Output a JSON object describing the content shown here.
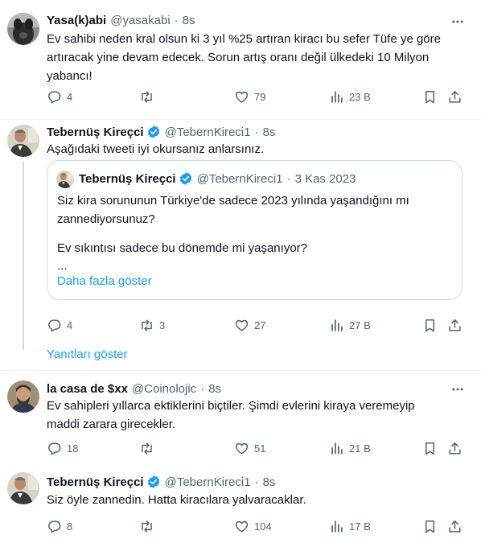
{
  "colors": {
    "accent": "#1d9bf0",
    "muted": "#536471",
    "text": "#0f1419",
    "border": "#cfd9de"
  },
  "tweets": [
    {
      "name": "Yasa(k)abi",
      "handle": "@yasakabi",
      "time": "8s",
      "verified": false,
      "text": "Ev sahibi neden kral olsun ki 3 yıl %25 artıran kiracı bu sefer Tüfe ye göre artıracak yine devam edecek. Sorun artış oranı değil ülkedeki 10 Milyon yabancı!",
      "replies": "4",
      "retweets": "",
      "likes": "79",
      "views": "23 B"
    },
    {
      "name": "Tebernüş Kireçci",
      "handle": "@TebernKireci1",
      "time": "8s",
      "verified": true,
      "text": "Aşağıdaki tweeti iyi okursanız anlarsınız.",
      "replies": "4",
      "retweets": "3",
      "likes": "27",
      "views": "27 B",
      "quote": {
        "name": "Tebernüş Kireçci",
        "handle": "@TebernKireci1",
        "date": "3 Kas 2023",
        "line1": "Siz kira sorununun Türkiye'de sadece 2023 yılında yaşandığını mı zannediyorsunuz?",
        "line2": "Ev sıkıntısı sadece bu dönemde mi yaşanıyor?",
        "ellipsis": "...",
        "show_more": "Daha fazla göster"
      }
    },
    {
      "name": "la casa de $xx",
      "handle": "@Coinolojic",
      "time": "8s",
      "verified": false,
      "text": "Ev sahipleri yıllarca ektiklerini biçtiler. Şimdi evlerini kiraya veremeyip maddi zarara girecekler.",
      "replies": "18",
      "retweets": "",
      "likes": "51",
      "views": "21 B"
    },
    {
      "name": "Tebernüş Kireçci",
      "handle": "@TebernKireci1",
      "time": "8s",
      "verified": true,
      "text": "Siz öyle zannedin. Hatta kiracılara yalvaracaklar.",
      "replies": "8",
      "retweets": "",
      "likes": "104",
      "views": "17 B"
    }
  ],
  "show_replies": "Yanıtları göster",
  "separator": "·",
  "icons": [
    "more-icon",
    "reply-icon",
    "retweet-icon",
    "like-icon",
    "views-icon",
    "bookmark-icon",
    "share-icon",
    "verified-icon"
  ]
}
